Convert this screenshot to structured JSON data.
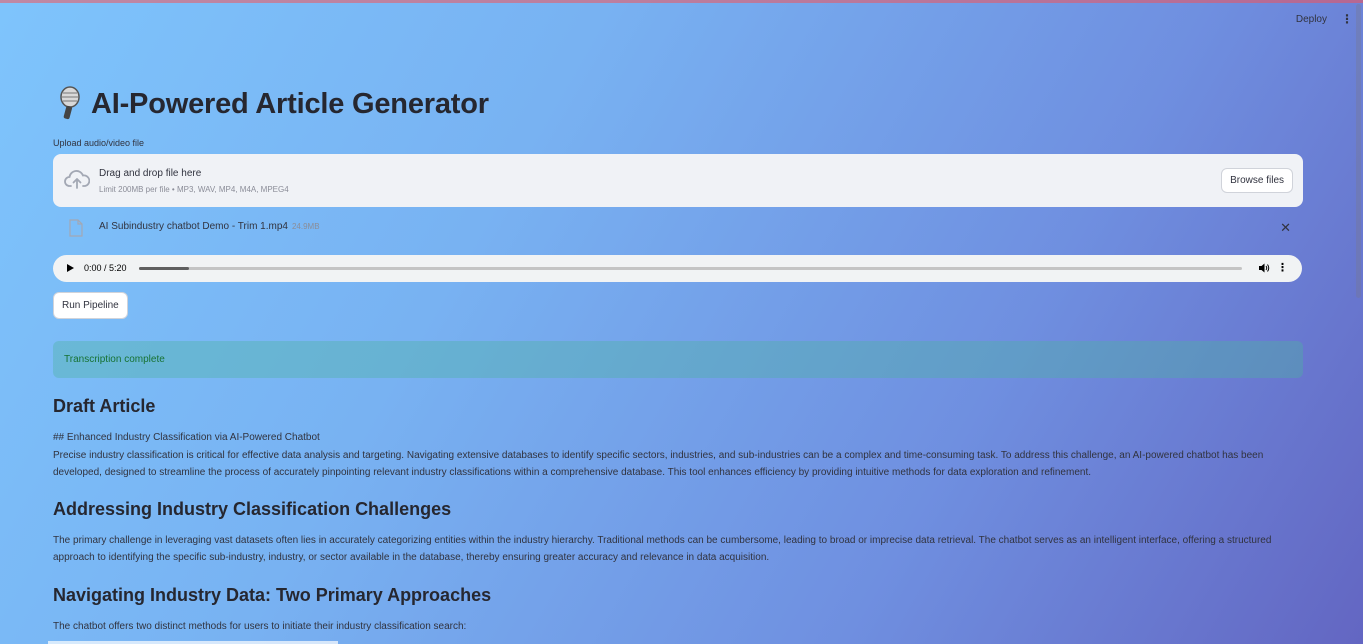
{
  "header": {
    "deploy_label": "Deploy",
    "menu_icon": "kebab-menu-icon"
  },
  "page": {
    "title": "AI-Powered Article Generator",
    "title_icon": "microphone-icon"
  },
  "uploader": {
    "label": "Upload audio/video file",
    "drop_title": "Drag and drop file here",
    "drop_subtitle": "Limit 200MB per file • MP3, WAV, MP4, M4A, MPEG4",
    "browse_label": "Browse files",
    "file": {
      "name": "AI Subindustry chatbot Demo - Trim 1.mp4",
      "size": "24.9MB"
    }
  },
  "audio": {
    "time": "0:00 / 5:20",
    "progress": 0.045
  },
  "run_button": "Run Pipeline",
  "status": "Transcription complete",
  "article": {
    "heading": "Draft Article",
    "intro_heading": "## Enhanced Industry Classification via AI-Powered Chatbot",
    "intro": "Precise industry classification is critical for effective data analysis and targeting. Navigating extensive databases to identify specific sectors, industries, and sub-industries can be a complex and time-consuming task. To address this challenge, an AI-powered chatbot has been developed, designed to streamline the process of accurately pinpointing relevant industry classifications within a comprehensive database. This tool enhances efficiency by providing intuitive methods for data exploration and refinement.",
    "section1_heading": "Addressing Industry Classification Challenges",
    "section1_text": "The primary challenge in leveraging vast datasets often lies in accurately categorizing entities within the industry hierarchy. Traditional methods can be cumbersome, leading to broad or imprecise data retrieval. The chatbot serves as an intelligent interface, offering a structured approach to identifying the specific sub-industry, industry, or sector available in the database, thereby ensuring greater accuracy and relevance in data acquisition.",
    "section2_heading": "Navigating Industry Data: Two Primary Approaches",
    "section2_text": "The chatbot offers two distinct methods for users to initiate their industry classification search:"
  }
}
